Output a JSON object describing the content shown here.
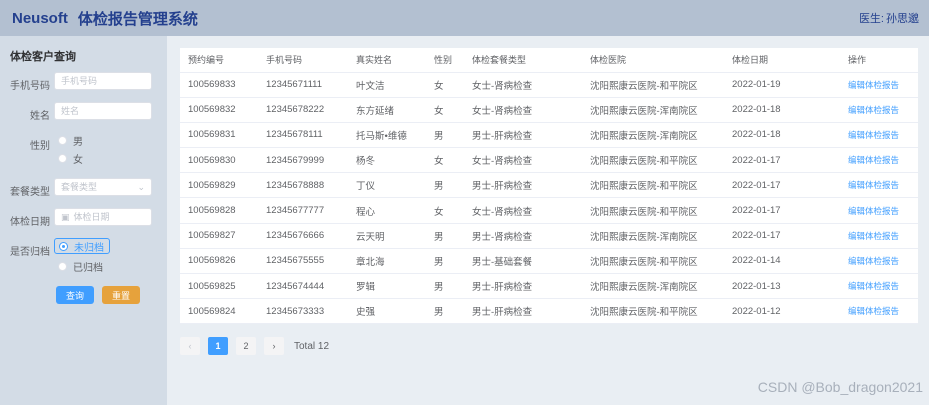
{
  "header": {
    "logo": "Neusoft",
    "title": "体检报告管理系统",
    "doctor_label": "医生:",
    "doctor_name": "孙思邈"
  },
  "sidebar": {
    "title": "体检客户查询",
    "phone": {
      "label": "手机号码",
      "placeholder": "手机号码"
    },
    "name": {
      "label": "姓名",
      "placeholder": "姓名"
    },
    "gender": {
      "label": "性别",
      "options": [
        "男",
        "女"
      ]
    },
    "package": {
      "label": "套餐类型",
      "placeholder": "套餐类型"
    },
    "date": {
      "label": "体检日期",
      "placeholder": "体检日期"
    },
    "archived": {
      "label": "是否归档",
      "options": [
        "未归档",
        "已归档"
      ],
      "selected": "未归档"
    },
    "search_label": "查询",
    "reset_label": "重置"
  },
  "table": {
    "columns": [
      "预约编号",
      "手机号码",
      "真实姓名",
      "性别",
      "体检套餐类型",
      "体检医院",
      "体检日期",
      "操作"
    ],
    "rows": [
      [
        "100569833",
        "12345671111",
        "叶文洁",
        "女",
        "女士-肾病检查",
        "沈阳熙康云医院-和平院区",
        "2022-01-19",
        "编辑体检报告"
      ],
      [
        "100569832",
        "12345678222",
        "东方延绪",
        "女",
        "女士-肾病检查",
        "沈阳熙康云医院-浑南院区",
        "2022-01-18",
        "编辑体检报告"
      ],
      [
        "100569831",
        "12345678111",
        "托马斯•维德",
        "男",
        "男士-肝病检查",
        "沈阳熙康云医院-浑南院区",
        "2022-01-18",
        "编辑体检报告"
      ],
      [
        "100569830",
        "12345679999",
        "杨冬",
        "女",
        "女士-肾病检查",
        "沈阳熙康云医院-和平院区",
        "2022-01-17",
        "编辑体检报告"
      ],
      [
        "100569829",
        "12345678888",
        "丁仪",
        "男",
        "男士-肝病检查",
        "沈阳熙康云医院-和平院区",
        "2022-01-17",
        "编辑体检报告"
      ],
      [
        "100569828",
        "12345677777",
        "程心",
        "女",
        "女士-肾病检查",
        "沈阳熙康云医院-和平院区",
        "2022-01-17",
        "编辑体检报告"
      ],
      [
        "100569827",
        "12345676666",
        "云天明",
        "男",
        "男士-肾病检查",
        "沈阳熙康云医院-浑南院区",
        "2022-01-17",
        "编辑体检报告"
      ],
      [
        "100569826",
        "12345675555",
        "章北海",
        "男",
        "男士-基础套餐",
        "沈阳熙康云医院-和平院区",
        "2022-01-14",
        "编辑体检报告"
      ],
      [
        "100569825",
        "12345674444",
        "罗辑",
        "男",
        "男士-肝病检查",
        "沈阳熙康云医院-浑南院区",
        "2022-01-13",
        "编辑体检报告"
      ],
      [
        "100569824",
        "12345673333",
        "史强",
        "男",
        "男士-肝病检查",
        "沈阳熙康云医院-和平院区",
        "2022-01-12",
        "编辑体检报告"
      ]
    ]
  },
  "pagination": {
    "prev": "‹",
    "pages": [
      "1",
      "2"
    ],
    "current": "1",
    "next": "›",
    "total": "Total 12"
  },
  "watermark": "CSDN @Bob_dragon2021",
  "icons": {
    "calendar": "calendar-icon",
    "chevron": "chevron-down-icon"
  },
  "colors": {
    "primary": "#409eff",
    "warning": "#e6a23c",
    "header": "#b3c0d1",
    "sidebar": "#d3dce6"
  }
}
